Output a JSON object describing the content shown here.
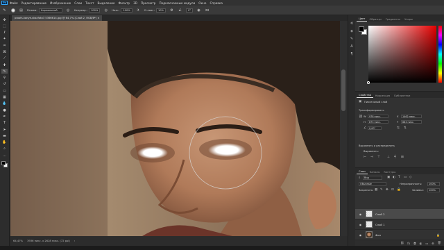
{
  "menu": {
    "logo": "Ps",
    "items": [
      "Файл",
      "Редактирование",
      "Изображение",
      "Слои",
      "Текст",
      "Выделение",
      "Фильтр",
      "3D",
      "Просмотр",
      "Подключаемые модули",
      "Окно",
      "Справка"
    ]
  },
  "options": {
    "mode_label": "Режим:",
    "mode_value": "Нормальный",
    "opacity_label": "Непрозр.:",
    "opacity_value": "100%",
    "flow_label": "Наж.:",
    "flow_value": "100%",
    "smoothing_label": "Сглаж.:",
    "smoothing_value": "10%",
    "angle_value": "0°"
  },
  "document": {
    "tab_title": "proofs-kanye-sbscfoto3 5366614.jpg @ 64,7% (Слой 2, RGB/8*) ×"
  },
  "status": {
    "zoom": "64,47%",
    "dimensions": "3936 пикс. x 2628 пикс. (72 ppi)"
  },
  "color_panel": {
    "tabs": [
      "Цвет",
      "Образцы",
      "Градиенты",
      "Узоры"
    ],
    "picker_hue": "#e50000"
  },
  "properties_panel": {
    "tabs": [
      "Свойства",
      "Коррекция",
      "Библиотеки"
    ],
    "layer_kind": "Пиксельный слой",
    "transform_heading": "Трансформировать",
    "w_value": "978 пикс.",
    "h_value": "873 пикс.",
    "x_value": "1462 пикс.",
    "y_value": "884 пикс.",
    "angle_value": "0,00°",
    "align_heading": "Выровнять и распределить",
    "align_sub": "Выровнять:"
  },
  "layers_panel": {
    "tabs": [
      "Слои",
      "Каналы",
      "Контуры"
    ],
    "filter_value": "Вид",
    "blend_value": "Обычные",
    "opacity_label": "Непрозрачность:",
    "opacity_value": "100%",
    "lock_label": "Закрепить:",
    "fill_label": "Заливка:",
    "fill_value": "100%",
    "layers": [
      {
        "name": "Слой 2",
        "selected": true,
        "thumb": "checker"
      },
      {
        "name": "Слой 1",
        "selected": false,
        "thumb": "checker"
      },
      {
        "name": "Фон",
        "selected": false,
        "thumb": "photo",
        "locked": true
      }
    ]
  }
}
